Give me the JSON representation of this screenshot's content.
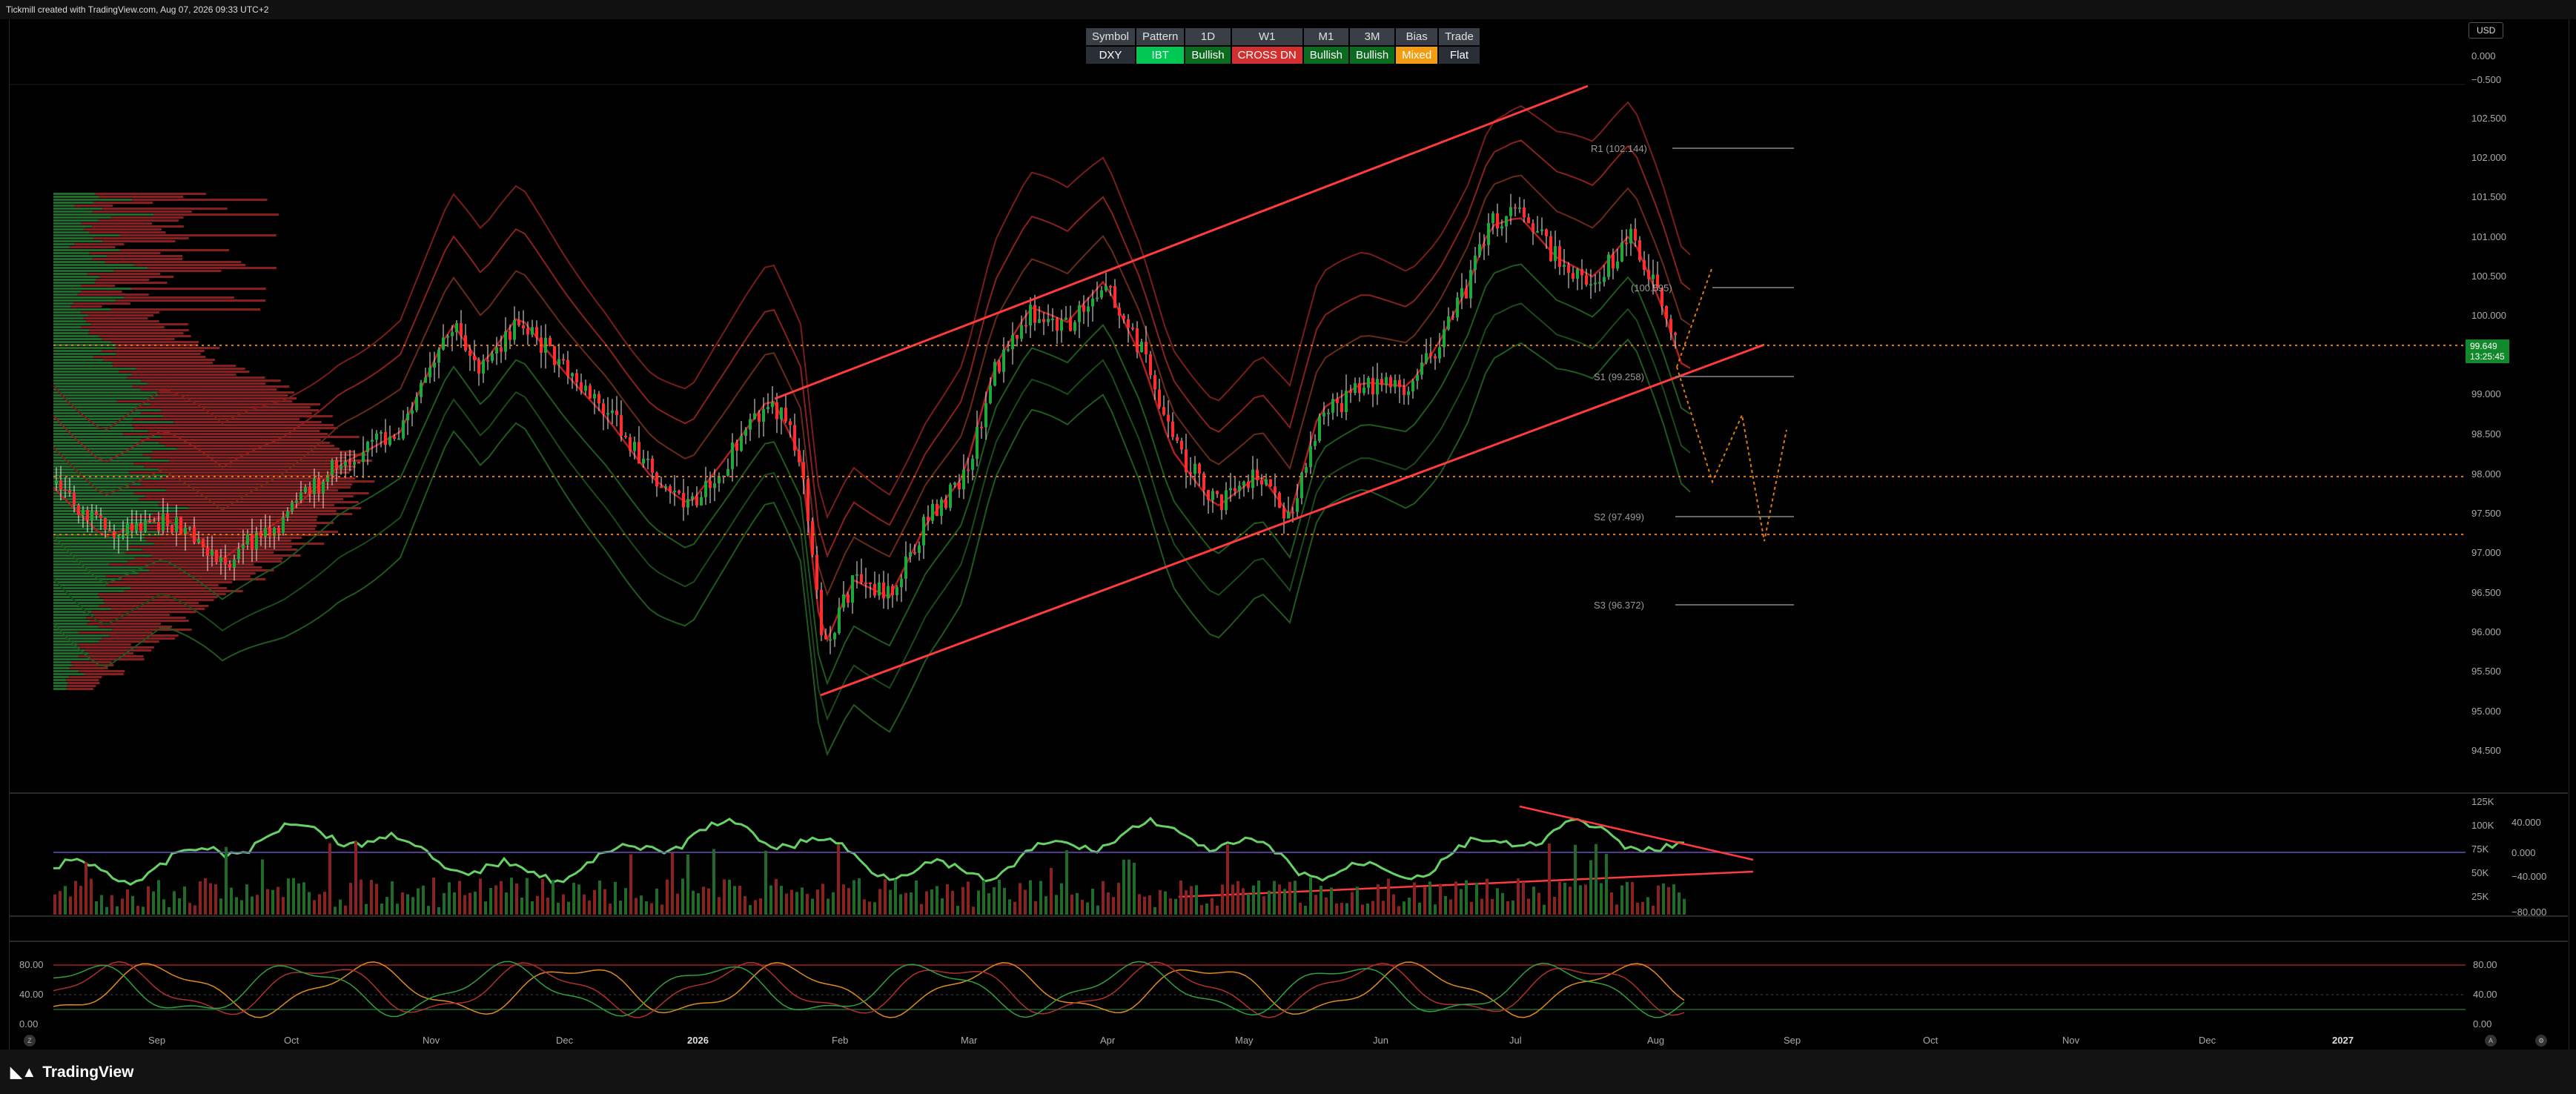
{
  "header": {
    "credit": "Tickmill created with TradingView.com, Aug 07, 2026 09:33 UTC+2"
  },
  "currency_button": "USD",
  "status_table": {
    "headers": [
      "Symbol",
      "Pattern",
      "1D",
      "W1",
      "M1",
      "3M",
      "Bias",
      "Trade"
    ],
    "values": [
      "DXY",
      "IBT",
      "Bullish",
      "CROSS DN",
      "Bullish",
      "Bullish",
      "Mixed",
      "Flat"
    ],
    "colors": [
      "#2a2e36",
      "#00c853",
      "#0b6b1e",
      "#d32f2f",
      "#0b6b1e",
      "#0b6b1e",
      "#f39c12",
      "#2a2e36"
    ]
  },
  "price_axis": [
    "102.500",
    "102.000",
    "101.500",
    "101.000",
    "100.500",
    "100.000",
    "99.000",
    "98.500",
    "98.000",
    "97.500",
    "97.000",
    "96.500",
    "96.000",
    "95.500",
    "95.000",
    "94.500"
  ],
  "price_axis_top": [
    "0.000",
    "−0.500"
  ],
  "live_price": {
    "value": "99.649",
    "countdown": "13:25:45"
  },
  "pivot_labels": [
    "R1 (102.144)",
    "(100.595)",
    "S1 (99.258)",
    "S2 (97.499)",
    "S3 (96.372)"
  ],
  "volume_axis": [
    "125K",
    "100K",
    "75K",
    "50K",
    "25K"
  ],
  "osc_axis": [
    "40.000",
    "0.000",
    "−40.000",
    "−80.000"
  ],
  "stoch_axis_left": [
    "80.00",
    "40.00",
    "0.00"
  ],
  "stoch_axis_right": [
    "80.00",
    "40.00",
    "0.00"
  ],
  "time_axis": {
    "labels": [
      "Sep",
      "Oct",
      "Nov",
      "Dec",
      "2026",
      "Feb",
      "Mar",
      "Apr",
      "May",
      "Jun",
      "Jul",
      "Aug",
      "Sep",
      "Oct",
      "Nov",
      "Dec",
      "2027"
    ],
    "years": [
      "2026",
      "2027"
    ]
  },
  "footer": {
    "brand": "TradingView"
  },
  "colors": {
    "up": "#1fa83a",
    "down": "#ff2d2d",
    "channel": "#ff3b3b",
    "dotted": "#e07a10"
  }
}
